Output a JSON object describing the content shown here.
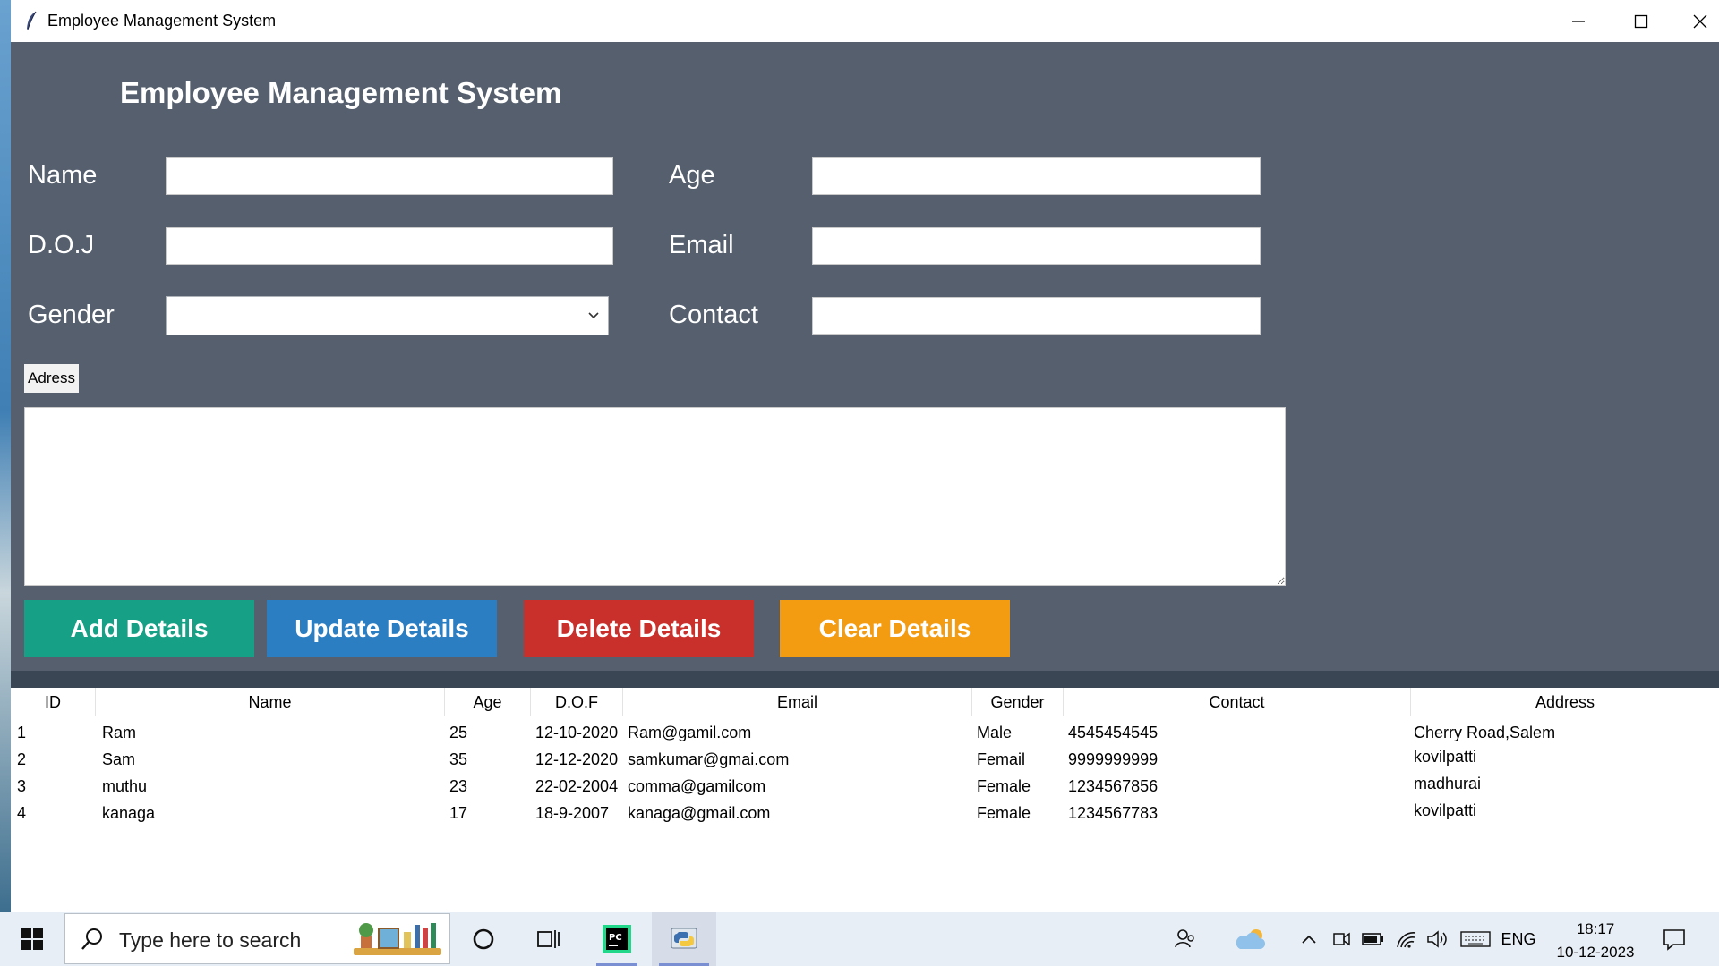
{
  "window": {
    "title": "Employee Management System",
    "controls": {
      "minimize": "minimize",
      "maximize": "maximize",
      "close": "close"
    }
  },
  "app": {
    "heading": "Employee Management System",
    "form": {
      "name_label": "Name",
      "age_label": "Age",
      "doj_label": "D.O.J",
      "email_label": "Email",
      "gender_label": "Gender",
      "contact_label": "Contact",
      "name_value": "",
      "age_value": "",
      "doj_value": "",
      "email_value": "",
      "gender_value": "",
      "contact_value": "",
      "address_label": "Adress",
      "address_value": ""
    },
    "buttons": {
      "add": "Add Details",
      "update": "Update Details",
      "delete": "Delete Details",
      "clear": "Clear Details"
    },
    "colors": {
      "add": "#16a085",
      "update": "#2b7ec1",
      "delete": "#c9302c",
      "clear": "#f39c12",
      "background": "#555f6e"
    }
  },
  "table": {
    "columns": [
      "ID",
      "Name",
      "Age",
      "D.O.F",
      "Email",
      "Gender",
      "Contact",
      "Address"
    ],
    "rows": [
      [
        "1",
        "Ram",
        "25",
        "12-10-2020",
        "Ram@gamil.com",
        "Male",
        "4545454545",
        "Cherry Road,Salem"
      ],
      [
        "2",
        "Sam",
        "35",
        "12-12-2020",
        "samkumar@gmai.com",
        "Femail",
        "9999999999",
        "kovilpatti"
      ],
      [
        "3",
        "muthu",
        "23",
        "22-02-2004",
        "comma@gamilcom",
        "Female",
        "1234567856",
        "madhurai"
      ],
      [
        "4",
        "kanaga",
        "17",
        "18-9-2007",
        "kanaga@gmail.com",
        "Female",
        "1234567783",
        "kovilpatti"
      ]
    ]
  },
  "taskbar": {
    "search_placeholder": "Type here to search",
    "language": "ENG",
    "time": "18:17",
    "date": "10-12-2023",
    "icons": [
      "windows-start-icon",
      "search-icon",
      "cortana-icon",
      "task-view-icon",
      "pycharm-icon",
      "python-icon",
      "people-icon",
      "weather-icon",
      "chevron-up-icon",
      "meet-now-icon",
      "battery-icon",
      "wifi-icon",
      "volume-icon",
      "keyboard-icon",
      "notification-icon"
    ]
  }
}
